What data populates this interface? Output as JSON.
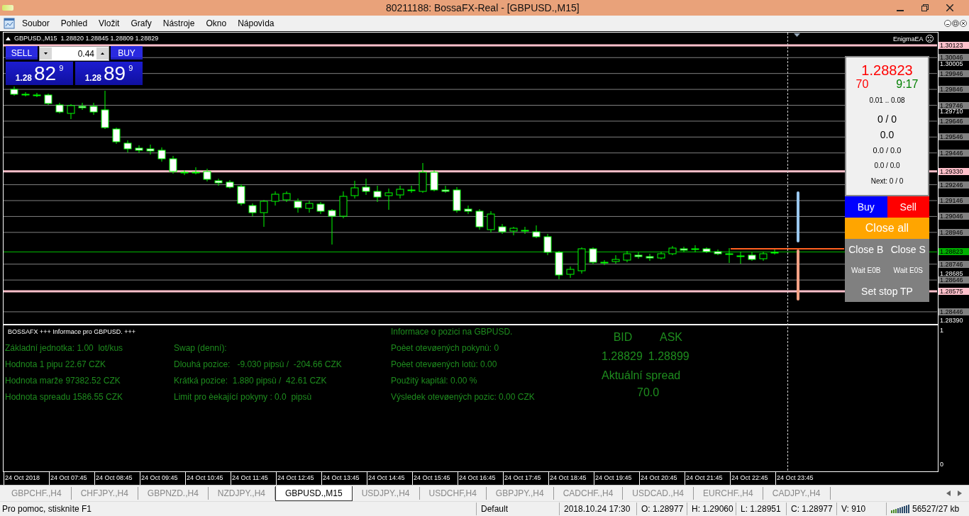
{
  "window": {
    "title": "80211188: BossaFX-Real - [GBPUSD.,M15]"
  },
  "menu": [
    "Soubor",
    "Pohled",
    "Vložit",
    "Grafy",
    "Nástroje",
    "Okno",
    "Nápovìda"
  ],
  "chart": {
    "header": "GBPUSD.,M15  1.28820 1.28845 1.28809 1.28829",
    "ea_name": "EnigmaEA",
    "one_click": {
      "sell": "SELL",
      "buy": "BUY",
      "lot": "0.44",
      "bid": {
        "prefix": "1.28",
        "big": "82",
        "pip": "9"
      },
      "ask": {
        "prefix": "1.28",
        "big": "89",
        "pip": "9"
      }
    },
    "price_labels": [
      {
        "text": "1.30123",
        "kind": "pink"
      },
      {
        "text": "1.30046",
        "kind": "box"
      },
      {
        "text": "1.30005",
        "kind": "plain"
      },
      {
        "text": "1.29946",
        "kind": "box"
      },
      {
        "text": "1.29846",
        "kind": "box"
      },
      {
        "text": "1.29746",
        "kind": "box"
      },
      {
        "text": "1.29710",
        "kind": "plain"
      },
      {
        "text": "1.29646",
        "kind": "box"
      },
      {
        "text": "1.29546",
        "kind": "box"
      },
      {
        "text": "1.29446",
        "kind": "box"
      },
      {
        "text": "1.29330",
        "kind": "pink"
      },
      {
        "text": "1.29246",
        "kind": "box"
      },
      {
        "text": "1.29146",
        "kind": "box"
      },
      {
        "text": "1.29046",
        "kind": "box"
      },
      {
        "text": "1.28946",
        "kind": "box"
      },
      {
        "text": "1.28823",
        "kind": "green"
      },
      {
        "text": "1.28746",
        "kind": "box"
      },
      {
        "text": "1.28685",
        "kind": "plain"
      },
      {
        "text": "1.28646",
        "kind": "box"
      },
      {
        "text": "1.28575",
        "kind": "pink"
      },
      {
        "text": "1.28446",
        "kind": "box"
      },
      {
        "text": "1.28390",
        "kind": "plain"
      }
    ],
    "time_labels": [
      "24 Oct 2018",
      "24 Oct 07:45",
      "24 Oct 08:45",
      "24 Oct 09:45",
      "24 Oct 10:45",
      "24 Oct 11:45",
      "24 Oct 12:45",
      "24 Oct 13:45",
      "24 Oct 14:45",
      "24 Oct 15:45",
      "24 Oct 16:45",
      "24 Oct 17:45",
      "24 Oct 18:45",
      "24 Oct 19:45",
      "24 Oct 20:45",
      "24 Oct 21:45",
      "24 Oct 22:45",
      "24 Oct 23:45"
    ],
    "sub_axis": [
      "1",
      "0"
    ],
    "ea_panel": {
      "price": "1.28823",
      "spread": "70",
      "timer": "9:17",
      "lots": "0.01 .. 0.08",
      "lines": [
        {
          "text": "0 / 0",
          "kind": "large"
        },
        {
          "text": "0.0",
          "kind": "large"
        },
        {
          "text": "0.0 / 0.0",
          "kind": "medium"
        },
        {
          "text": "0.0 / 0.0",
          "kind": "small"
        },
        {
          "text": "Next: 0 / 0",
          "kind": "small"
        }
      ],
      "button_rows": [
        {
          "kind": "large",
          "buttons": [
            {
              "label": "Buy",
              "color": "#0000ff"
            },
            {
              "label": "Sell",
              "color": "#ff0000"
            }
          ]
        },
        {
          "kind": "large",
          "buttons": [
            {
              "label": "Close all",
              "color": "#ffa500"
            }
          ]
        },
        {
          "kind": "large",
          "buttons": [
            {
              "label": "Close B",
              "color": "#808080"
            },
            {
              "label": "Close S",
              "color": "#808080"
            }
          ]
        },
        {
          "kind": "small",
          "buttons": [
            {
              "label": "Wait E0B",
              "color": "#808080"
            },
            {
              "label": "Wait E0S",
              "color": "#808080"
            }
          ]
        },
        {
          "kind": "large",
          "buttons": [
            {
              "label": "Set stop TP",
              "color": "#808080"
            }
          ]
        }
      ]
    },
    "info": {
      "title": "BOSSAFX +++ Informace pro GBPUSD. +++",
      "col1": [
        "Základní jednotka: 1.00  lot/kus",
        "Hodnota 1 pipu 22.67 CZK",
        "Hodnota marže 97382.52 CZK",
        "Hodnota spreadu 1586.55 CZK"
      ],
      "col2": [
        "Swap (denní):",
        "Dlouhá pozice:   -9.030 pipsù /  -204.66 CZK",
        "Krátká pozice:  1.880 pipsù /  42.61 CZK",
        "Limit pro èekající pokyny : 0.0  pipsù"
      ],
      "col3": [
        "Informace o pozici na GBPUSD.",
        "Poèet otevøených pokynù: 0",
        "Poèet otevøených lotù: 0.00",
        "Použitý kapitál: 0.00 %",
        "Výsledek otevøených pozic: 0.00 CZK"
      ],
      "quotes": {
        "bid_label": "BID",
        "ask_label": "ASK",
        "bid": "1.28829",
        "ask": "1.28899",
        "spread_label": "Aktuální spread",
        "spread": "70.0"
      }
    }
  },
  "tabs": [
    {
      "label": "GBPCHF.,H4",
      "selected": false
    },
    {
      "label": "CHFJPY.,H4",
      "selected": false
    },
    {
      "label": "GBPNZD.,H4",
      "selected": false
    },
    {
      "label": "NZDJPY.,H4",
      "selected": false
    },
    {
      "label": "GBPUSD.,M15",
      "selected": true
    },
    {
      "label": "USDJPY.,H4",
      "selected": false
    },
    {
      "label": "USDCHF,H4",
      "selected": false
    },
    {
      "label": "GBPJPY.,H4",
      "selected": false
    },
    {
      "label": "CADCHF.,H4",
      "selected": false
    },
    {
      "label": "USDCAD.,H4",
      "selected": false
    },
    {
      "label": "EURCHF.,H4",
      "selected": false
    },
    {
      "label": "CADJPY.,H4",
      "selected": false
    }
  ],
  "status_bar": {
    "help": "Pro pomoc, stisknìte F1",
    "fields": [
      "Default",
      "2018.10.24 17:30",
      "O: 1.28977",
      "H: 1.29060",
      "L: 1.28951",
      "C: 1.28977",
      "V: 910"
    ],
    "traffic": "56527/27 kb"
  }
}
